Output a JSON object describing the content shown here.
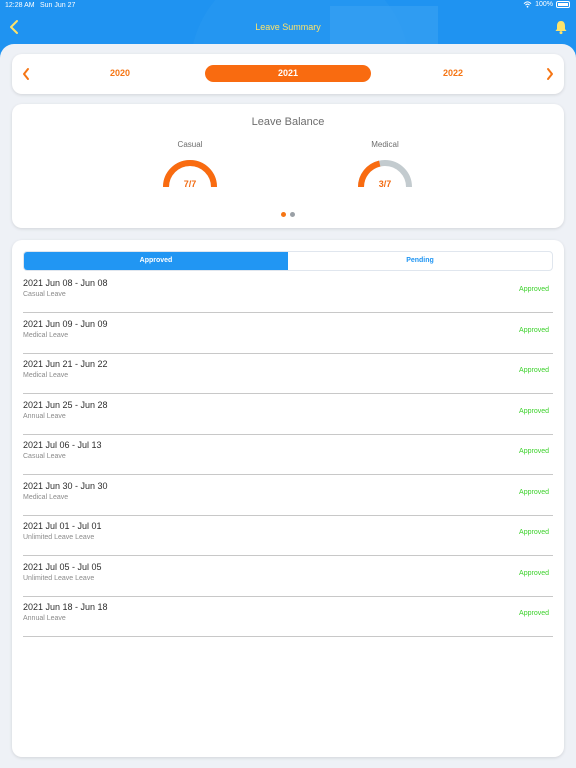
{
  "status_bar": {
    "time": "12:28 AM",
    "date": "Sun Jun 27",
    "battery": "100%"
  },
  "navbar": {
    "title": "Leave Summary",
    "back_icon": "chevron-left-icon",
    "bell_icon": "bell-icon"
  },
  "colors": {
    "primary": "#2196f3",
    "accent": "#f96b10",
    "approved": "#3bd12a",
    "title": "#fde36a",
    "gauge_track": "#c3cbcf"
  },
  "years": {
    "prev": "2020",
    "current": "2021",
    "next": "2022"
  },
  "balance": {
    "title": "Leave Balance",
    "gauges": [
      {
        "label": "Casual",
        "value": "7/7",
        "fraction": 1.0
      },
      {
        "label": "Medical",
        "value": "3/7",
        "fraction": 0.4286
      }
    ],
    "page_index": 0,
    "page_count": 2
  },
  "tabs": {
    "approved": "Approved",
    "pending": "Pending",
    "active": "approved"
  },
  "leaves": [
    {
      "dates": "2021 Jun 08 - Jun 08",
      "type": "Casual Leave",
      "status": "Approved"
    },
    {
      "dates": "2021 Jun 09 - Jun 09",
      "type": "Medical Leave",
      "status": "Approved"
    },
    {
      "dates": "2021 Jun 21 - Jun 22",
      "type": "Medical Leave",
      "status": "Approved"
    },
    {
      "dates": "2021 Jun 25 - Jun 28",
      "type": "Annual Leave",
      "status": "Approved"
    },
    {
      "dates": "2021 Jul 06 - Jul 13",
      "type": "Casual Leave",
      "status": "Approved"
    },
    {
      "dates": "2021 Jun 30 - Jun 30",
      "type": "Medical Leave",
      "status": "Approved"
    },
    {
      "dates": "2021 Jul 01 - Jul 01",
      "type": "Unlimited Leave Leave",
      "status": "Approved"
    },
    {
      "dates": "2021 Jul 05 - Jul 05",
      "type": "Unlimited Leave Leave",
      "status": "Approved"
    },
    {
      "dates": "2021 Jun 18 - Jun 18",
      "type": "Annual Leave",
      "status": "Approved"
    }
  ]
}
